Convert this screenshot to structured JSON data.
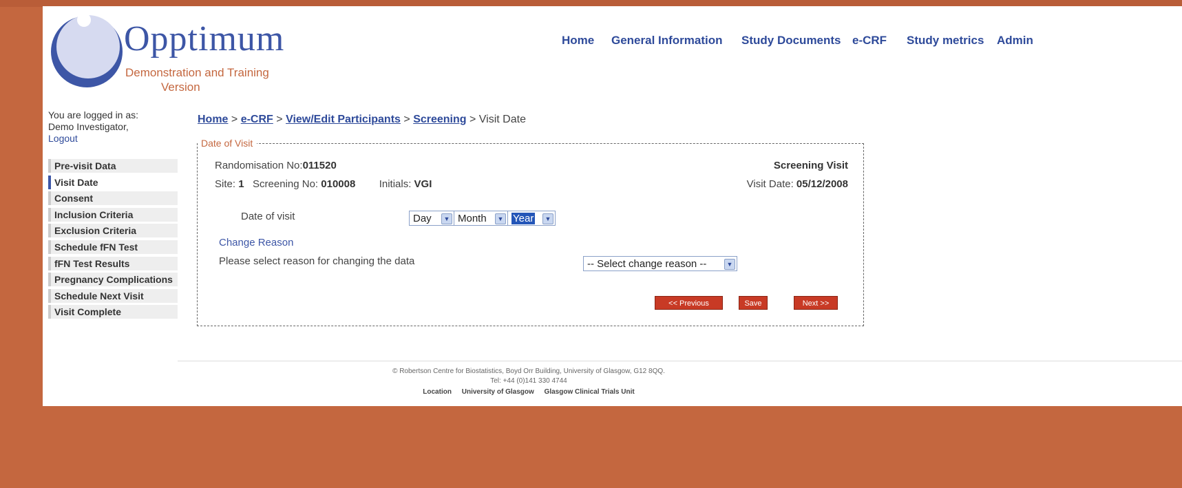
{
  "header": {
    "logo_title": "Opptimum",
    "logo_subtitle_line1": "Demonstration and Training",
    "logo_subtitle_line2": "Version"
  },
  "nav": [
    {
      "label": "Home"
    },
    {
      "label": "General Information"
    },
    {
      "label": "Study Documents"
    },
    {
      "label": "e-CRF"
    },
    {
      "label": "Study metrics"
    },
    {
      "label": "Admin"
    }
  ],
  "user": {
    "logged_in_label": "You are logged in as:",
    "name": "Demo Investigator,",
    "logout": "Logout"
  },
  "sidebar": {
    "items": [
      {
        "label": "Pre-visit Data"
      },
      {
        "label": "Visit Date",
        "active": true
      },
      {
        "label": "Consent"
      },
      {
        "label": "Inclusion Criteria"
      },
      {
        "label": "Exclusion Criteria"
      },
      {
        "label": "Schedule fFN Test"
      },
      {
        "label": "fFN Test Results"
      },
      {
        "label": "Pregnancy Complications"
      },
      {
        "label": "Schedule Next Visit"
      },
      {
        "label": "Visit Complete"
      }
    ]
  },
  "breadcrumb": {
    "items": [
      "Home",
      "e-CRF",
      "View/Edit Participants",
      "Screening"
    ],
    "current": "Visit Date",
    "separator": ">"
  },
  "form": {
    "legend": "Date of Visit",
    "randomisation_label": "Randomisation No:",
    "randomisation_value": "011520",
    "visit_type": "Screening Visit",
    "site_label": "Site:",
    "site_value": "1",
    "screening_label": "Screening No:",
    "screening_value": "010008",
    "initials_label": "Initials:",
    "initials_value": "VGI",
    "visit_date_label": "Visit Date:",
    "visit_date_value": "05/12/2008",
    "date_of_visit_label": "Date of visit",
    "day_select": "Day",
    "month_select": "Month",
    "year_select": "Year",
    "change_reason_heading": "Change Reason",
    "change_reason_prompt": "Please select reason for changing the data",
    "change_reason_select": "-- Select change reason --",
    "previous_button": "<< Previous",
    "save_button": "Save",
    "next_button": "Next >>"
  },
  "footer": {
    "address": "© Robertson Centre for Biostatistics, Boyd Orr Building, University of Glasgow, G12 8QQ.",
    "tel": "Tel: +44 (0)141 330 4744",
    "links": [
      "Location",
      "University of Glasgow",
      "Glasgow Clinical Trials Unit"
    ]
  },
  "colors": {
    "frame": "#c4673f",
    "brand_blue": "#3d56a6",
    "button_red": "#c83a25"
  }
}
